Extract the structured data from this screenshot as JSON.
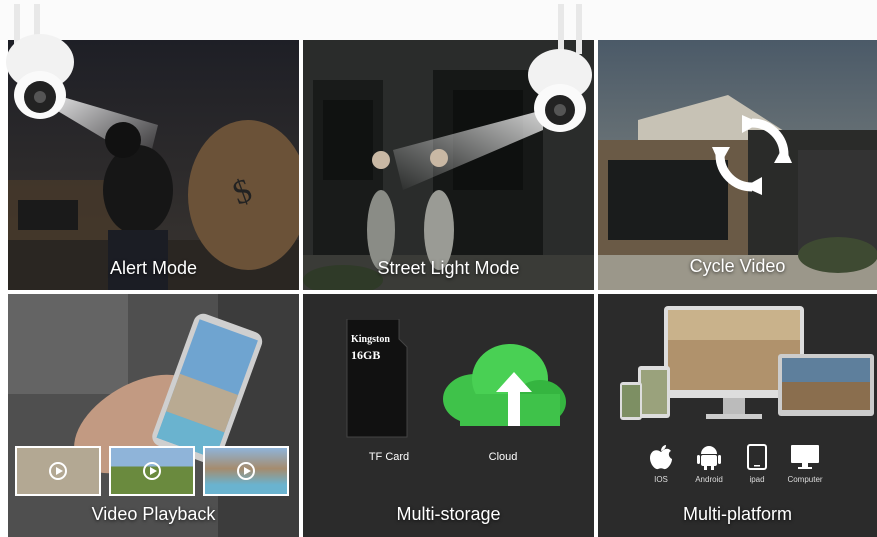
{
  "tiles": {
    "alert": {
      "caption": "Alert Mode"
    },
    "street": {
      "caption": "Street Light Mode"
    },
    "cycle": {
      "caption": "Cycle Video"
    },
    "playback": {
      "caption": "Video Playback"
    },
    "storage": {
      "caption": "Multi-storage",
      "card_label": "TF Card",
      "cloud_label": "Cloud",
      "card_brand": "Kingston",
      "card_size": "16GB"
    },
    "platform": {
      "caption": "Multi-platform",
      "devices": [
        "IOS",
        "Android",
        "ipad",
        "Computer"
      ]
    }
  },
  "icons": [
    "camera-icon",
    "refresh-cycle-icon",
    "play-icon",
    "cloud-upload-icon",
    "apple-icon",
    "android-icon",
    "tablet-icon",
    "computer-icon"
  ],
  "colors": {
    "tile_dark": "#2b2b2b",
    "cloud_green": "#3fc24a",
    "caption": "#ffffff"
  }
}
